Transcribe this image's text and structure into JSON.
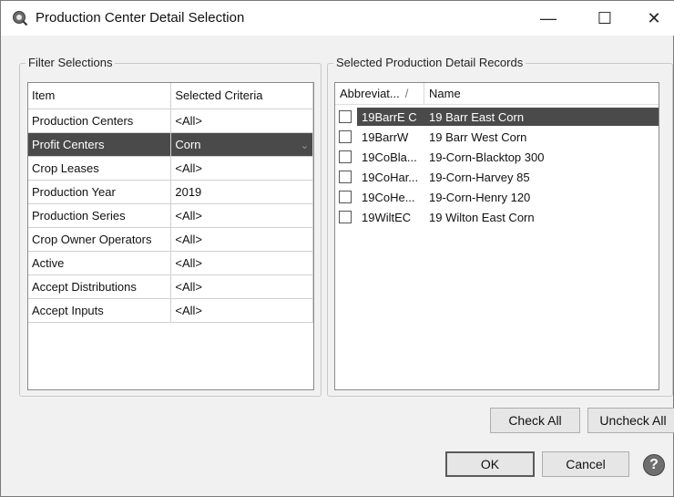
{
  "window": {
    "title": "Production Center Detail Selection",
    "minimize_glyph": "—",
    "maximize_glyph": "☐",
    "close_glyph": "✕"
  },
  "filter_selections": {
    "label": "Filter Selections",
    "headers": {
      "item": "Item",
      "criteria": "Selected Criteria"
    },
    "rows": [
      {
        "item": "Production Centers",
        "criteria": "<All>"
      },
      {
        "item": "Profit Centers",
        "criteria": "Corn",
        "selected": true
      },
      {
        "item": "Crop Leases",
        "criteria": "<All>"
      },
      {
        "item": "Production Year",
        "criteria": "2019"
      },
      {
        "item": "Production Series",
        "criteria": "<All>"
      },
      {
        "item": "Crop Owner Operators",
        "criteria": "<All>"
      },
      {
        "item": "Active",
        "criteria": "<All>"
      },
      {
        "item": "Accept Distributions",
        "criteria": "<All>"
      },
      {
        "item": "Accept Inputs",
        "criteria": "<All>"
      }
    ]
  },
  "records": {
    "label": "Selected Production Detail Records",
    "headers": {
      "abbreviation": "Abbreviat...",
      "name": "Name",
      "sort_glyph": "/"
    },
    "rows": [
      {
        "abbr": "19BarrE C",
        "name": "19 Barr East Corn",
        "checked": false,
        "selected": true
      },
      {
        "abbr": "19BarrW",
        "name": "19 Barr West Corn",
        "checked": false
      },
      {
        "abbr": "19CoBla...",
        "name": "19-Corn-Blacktop 300",
        "checked": false
      },
      {
        "abbr": "19CoHar...",
        "name": "19-Corn-Harvey 85",
        "checked": false
      },
      {
        "abbr": "19CoHe...",
        "name": "19-Corn-Henry 120",
        "checked": false
      },
      {
        "abbr": "19WiltEC",
        "name": "19 Wilton East Corn",
        "checked": false
      }
    ]
  },
  "buttons": {
    "check_all": "Check All",
    "uncheck_all": "Uncheck All",
    "ok": "OK",
    "cancel": "Cancel",
    "help_glyph": "?"
  },
  "colors": {
    "selection": "#4a4a4a",
    "window_bg": "#f1f1f1"
  }
}
